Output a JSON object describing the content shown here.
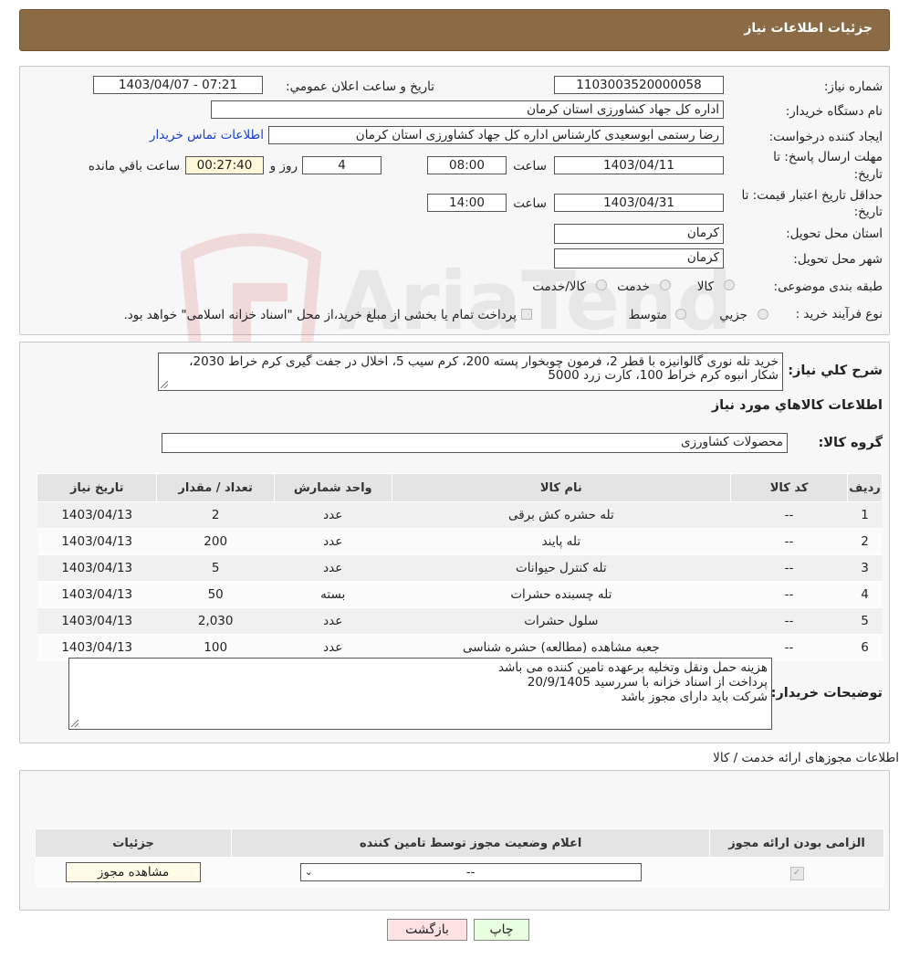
{
  "header": {
    "title": "جزئیات اطلاعات نیاز"
  },
  "form": {
    "need_number_label": "شماره نیاز:",
    "need_number": "1103003520000058",
    "announce_label": "تاریخ و ساعت اعلان عمومي:",
    "announce_value": "1403/04/07 - 07:21",
    "buyer_org_label": "نام دستگاه خريدار:",
    "buyer_org": "اداره کل جهاد کشاورزی استان کرمان",
    "creator_label": "ايجاد کننده درخواست:",
    "creator": "رضا رستمی ابوسعیدی کارشناس اداره کل جهاد کشاورزی استان کرمان",
    "contact_link": "اطلاعات تماس خريدار",
    "deadline_label_1": "مهلت ارسال پاسخ: تا",
    "deadline_label_2": "تاريخ:",
    "deadline_date": "1403/04/11",
    "time_label": "ساعت",
    "deadline_time": "08:00",
    "days": "4",
    "days_label": "روز و",
    "remaining": "00:27:40",
    "remaining_label": "ساعت باقي مانده",
    "validity_label_1": "حداقل تاريخ اعتبار قيمت: تا",
    "validity_label_2": "تاريخ:",
    "validity_date": "1403/04/31",
    "validity_time": "14:00",
    "province_label": "استان محل تحويل:",
    "province": "کرمان",
    "city_label": "شهر محل تحويل:",
    "city": "کرمان",
    "category_label": "طبقه بندی موضوعی:",
    "category_options": [
      "کالا",
      "خدمت",
      "کالا/خدمت"
    ],
    "process_label": "نوع فرآيند خريد :",
    "process_options": [
      "جزيي",
      "متوسط"
    ],
    "process_note": "پرداخت تمام يا بخشی از مبلغ خريد،از محل \"اسناد خزانه اسلامی\" خواهد بود."
  },
  "description": {
    "label": "شرح کلي نياز:",
    "text": "خرید تله نوری گالوانیزه با قطر 2، فرمون چوبخوار پسته 200، کرم سیب 5، اخلال در جفت گیری کرم خراط 2030، شکار انبوه کرم خراط 100، کارت زرد 5000"
  },
  "goods": {
    "section_title": "اطلاعات کالاهاي مورد نياز",
    "group_label": "گروه کالا:",
    "group_value": "محصولات کشاورزی",
    "columns": [
      "رديف",
      "کد کالا",
      "نام کالا",
      "واحد شمارش",
      "تعداد / مقدار",
      "تاريخ نياز"
    ],
    "rows": [
      [
        "1",
        "--",
        "تله حشره کش برقی",
        "عدد",
        "2",
        "1403/04/13"
      ],
      [
        "2",
        "--",
        "تله پایند",
        "عدد",
        "200",
        "1403/04/13"
      ],
      [
        "3",
        "--",
        "تله کنترل حیوانات",
        "عدد",
        "5",
        "1403/04/13"
      ],
      [
        "4",
        "--",
        "تله چسبنده حشرات",
        "بسته",
        "50",
        "1403/04/13"
      ],
      [
        "5",
        "--",
        "سلول حشرات",
        "عدد",
        "2,030",
        "1403/04/13"
      ],
      [
        "6",
        "--",
        "جعبه مشاهده (مطالعه) حشره شناسی",
        "عدد",
        "100",
        "1403/04/13"
      ]
    ]
  },
  "buyer_notes": {
    "label": "توضيحات خريدار:",
    "lines": [
      "هزینه حمل ونقل وتخلیه برعهده تامین کننده می باشد",
      "پرداخت از اسناد  خزانه با سررسید 20/9/1405",
      "شرکت باید دارای مجوز باشد"
    ]
  },
  "permits": {
    "section_title": "اطلاعات مجوزهای ارائه خدمت / کالا",
    "columns": [
      "الزامی بودن ارائه مجوز",
      "اعلام وضعیت مجوز توسط تامین کننده",
      "جزئیات"
    ],
    "select_value": "--",
    "view_button": "مشاهده مجوز"
  },
  "actions": {
    "print": "چاپ",
    "back": "بازگشت"
  },
  "colors": {
    "header": "#8b6a46",
    "link": "#1a3fd0",
    "back_button": "#ffe3e3",
    "print_button": "#e8ffe0"
  }
}
